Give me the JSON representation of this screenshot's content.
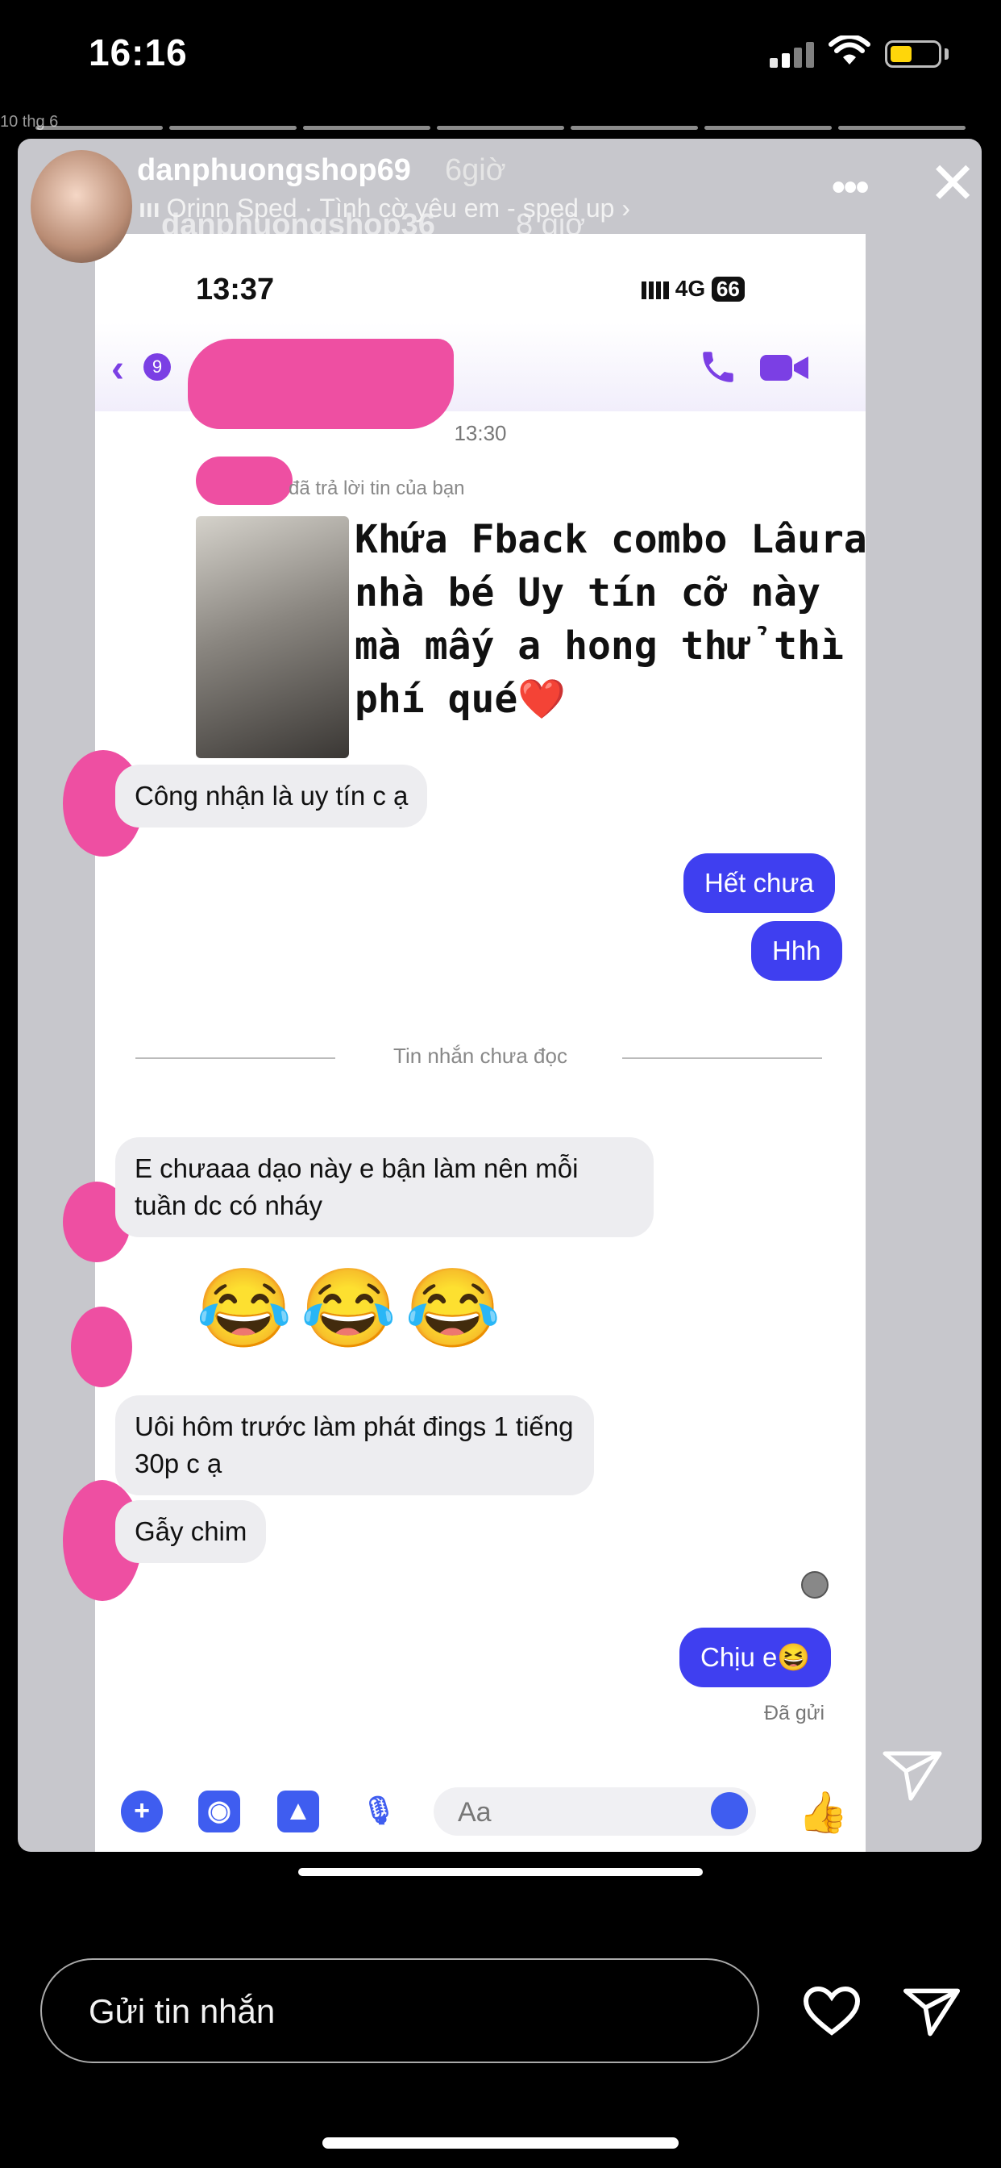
{
  "status_bar": {
    "time": "16:16"
  },
  "story": {
    "username": "danphuongshop69",
    "age": "6giờ",
    "music": "Orinn Sped · Tình cờ yêu em - sped up ›",
    "ghost_username": "danphuongshop36",
    "ghost_age": "8 giờ",
    "ghost_date": "10 thg 6"
  },
  "screenshot": {
    "time": "13:37",
    "network": "4G",
    "battery": "66",
    "back_count": "9",
    "chat_time": "13:30",
    "reply_label": "đã trả lời tin của bạn",
    "reply_story_text": "Khứa Fback combo Lâura nhà bé Uy tín cỡ này mà mấy a hong thử thì phí qué❤️",
    "messages": [
      {
        "side": "in",
        "text": "Công nhận là uy tín c ạ"
      },
      {
        "side": "out",
        "text": "Hết chưa"
      },
      {
        "side": "out",
        "text": "Hhh"
      },
      {
        "side": "in",
        "text": "E chưaaa dạo này e bận làm nên mỗi tuần dc có nháy"
      },
      {
        "side": "in",
        "text": "😂😂😂"
      },
      {
        "side": "in",
        "text": "Uôi hôm trước làm phát đings 1 tiếng 30p c ạ"
      },
      {
        "side": "in",
        "text": "Gẫy chim"
      },
      {
        "side": "out",
        "text": "Chịu e😆"
      }
    ],
    "unread_divider": "Tin nhắn chưa đọc",
    "sent_status": "Đã gửi",
    "composer_placeholder": "Aa"
  },
  "reply_bar": {
    "placeholder": "Gửi tin nhắn"
  },
  "colors": {
    "accent": "#7b3fe4",
    "outgoing_bubble": "#3f3ff0",
    "redaction": "#ee4fa2",
    "composer_icons": "#3f5df0"
  },
  "icons": [
    "cellular-signal-icon",
    "wifi-icon",
    "battery-icon",
    "more-icon",
    "close-icon",
    "music-bars-icon",
    "back-chevron-icon",
    "phone-icon",
    "video-icon",
    "add-icon",
    "camera-icon",
    "gallery-icon",
    "microphone-icon",
    "emoji-icon",
    "thumbs-up-icon",
    "heart-icon",
    "send-icon",
    "share-icon"
  ]
}
